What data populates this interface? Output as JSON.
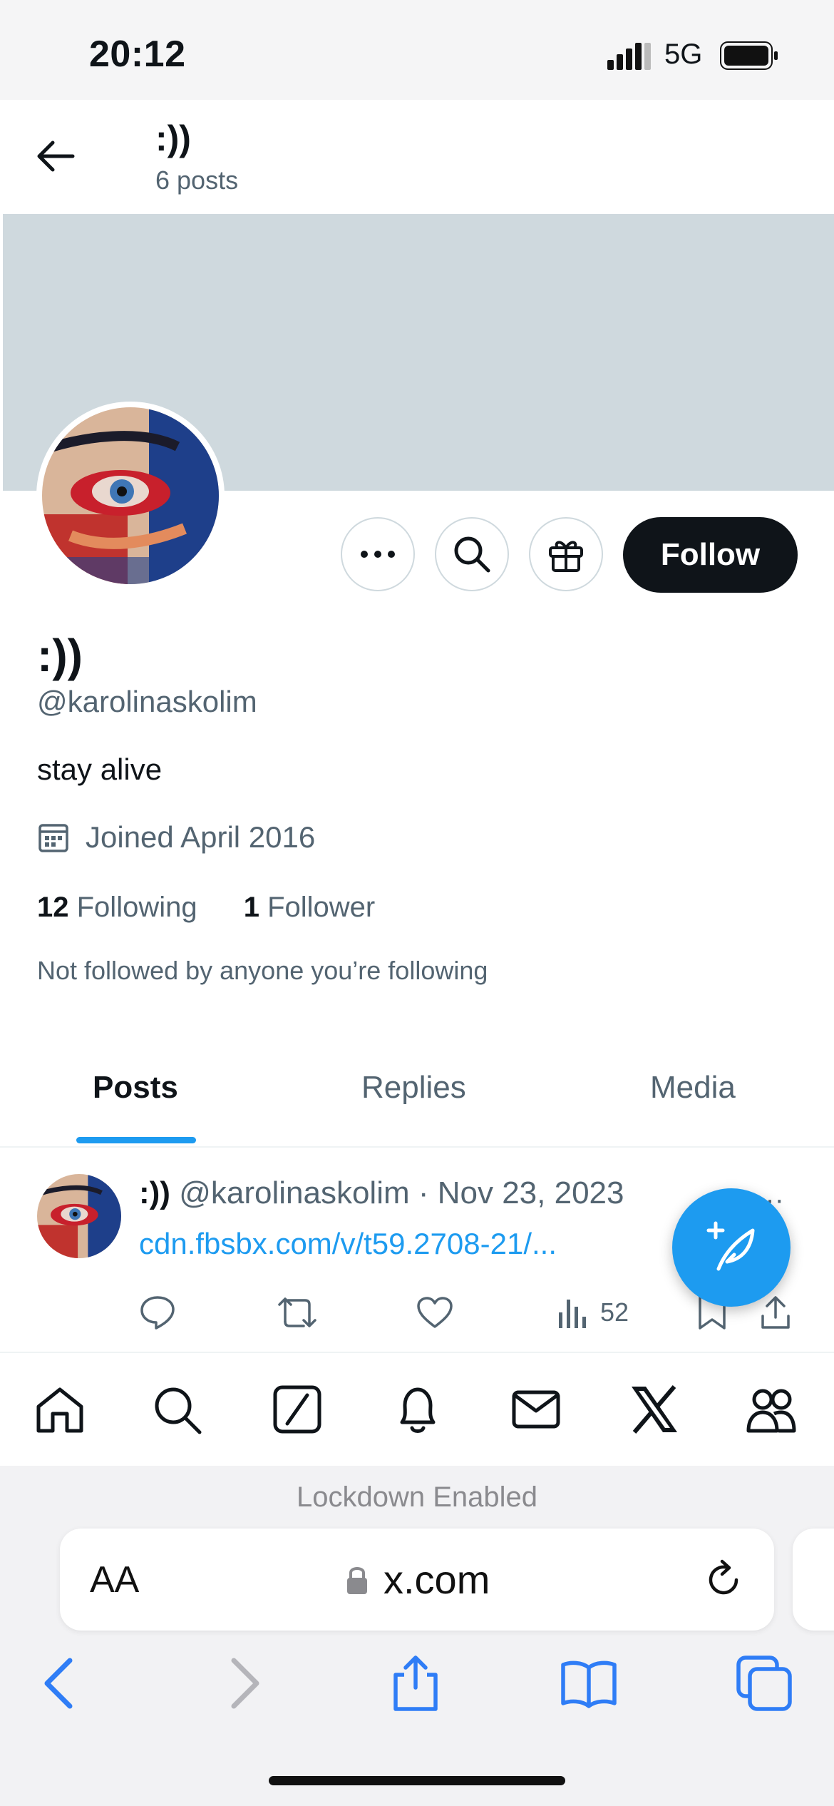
{
  "status": {
    "time": "20:12",
    "network": "5G"
  },
  "header": {
    "title": ":))",
    "subtitle": "6 posts"
  },
  "profile": {
    "name": ":))",
    "handle": "@karolinaskolim",
    "bio": "stay alive",
    "joined": "Joined April 2016",
    "following_count": "12",
    "following_label": "Following",
    "followers_count": "1",
    "followers_label": "Follower",
    "not_followed": "Not followed by anyone you’re following",
    "follow_label": "Follow"
  },
  "tabs": [
    {
      "label": "Posts",
      "active": true
    },
    {
      "label": "Replies",
      "active": false
    },
    {
      "label": "Media",
      "active": false
    }
  ],
  "post": {
    "name": ":))",
    "handle_date": "@karolinaskolim · Nov 23, 2023",
    "link": "cdn.fbsbx.com/v/t59.2708-21/...",
    "more": "···",
    "views": "52"
  },
  "safari": {
    "lockdown": "Lockdown Enabled",
    "aa": "AA",
    "url": "x.com"
  },
  "colors": {
    "accent": "#1d9bf0",
    "banner": "#cfd9de",
    "text": "#0f1419",
    "muted": "#536471"
  },
  "icons": [
    "back-arrow-icon",
    "more-icon",
    "search-icon",
    "gift-icon",
    "calendar-icon",
    "reply-icon",
    "retweet-icon",
    "like-icon",
    "views-icon",
    "bookmark-icon",
    "share-icon",
    "compose-icon",
    "home-icon",
    "grok-icon",
    "bell-icon",
    "mail-icon",
    "x-logo-icon",
    "communities-icon",
    "lock-icon",
    "reload-icon"
  ]
}
